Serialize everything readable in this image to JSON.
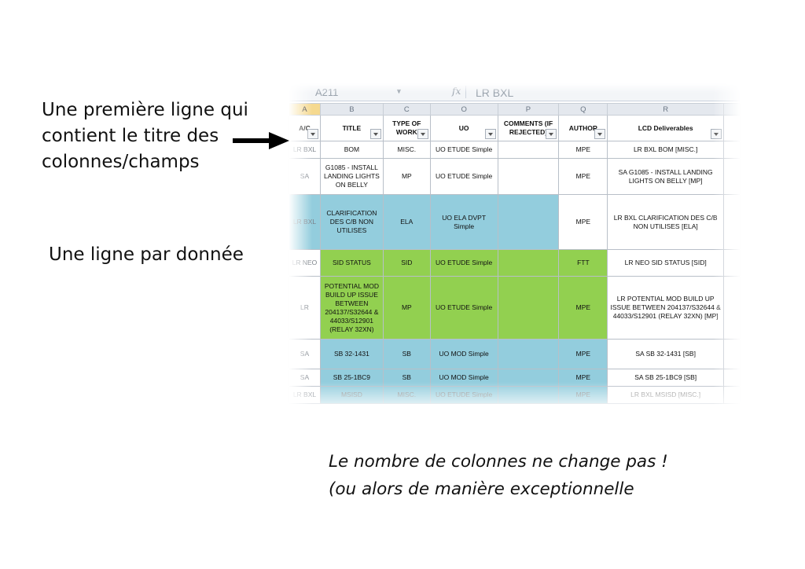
{
  "annotations": {
    "header_callout": "Une première ligne qui contient le titre des colonnes/champs",
    "row_callout": "Une ligne par donnée",
    "footer_line1": "Le nombre de colonnes ne change pas !",
    "footer_line2": "(ou alors de manière exceptionnelle"
  },
  "spreadsheet": {
    "name_box": "A211",
    "fx_icon": "fx-icon",
    "formula_value": "LR BXL",
    "column_letters": [
      "A",
      "B",
      "C",
      "O",
      "P",
      "Q",
      "R"
    ],
    "column_headers": [
      "A/C",
      "TITLE",
      "TYPE OF WORK",
      "UO",
      "COMMENTS (IF REJECTED)",
      "AUTHOR",
      "LCD Deliverables"
    ],
    "rows": [
      {
        "color": "white",
        "ac": "LR BXL",
        "title": "BOM",
        "type": "MISC.",
        "uo": "UO ETUDE Simple",
        "comments": "",
        "author": "MPE",
        "lcd": "LR BXL BOM [MISC.]"
      },
      {
        "color": "white",
        "ac": "SA",
        "title": "G1085 - INSTALL LANDING LIGHTS ON BELLY",
        "type": "MP",
        "uo": "UO ETUDE Simple",
        "comments": "",
        "author": "MPE",
        "lcd": "SA G1085 - INSTALL LANDING LIGHTS ON BELLY [MP]"
      },
      {
        "color": "blue",
        "ac": "LR BXL",
        "title": "CLARIFICATION DES C/B NON UTILISES",
        "type": "ELA",
        "uo": "UO ELA DVPT Simple",
        "comments": "",
        "author": "MPE",
        "lcd": "LR BXL CLARIFICATION DES C/B NON UTILISES [ELA]"
      },
      {
        "color": "green",
        "ac": "LR NEO",
        "title": "SID STATUS",
        "type": "SID",
        "uo": "UO ETUDE Simple",
        "comments": "",
        "author": "FTT",
        "lcd": "LR NEO SID STATUS [SID]"
      },
      {
        "color": "green",
        "ac": "LR",
        "title": "POTENTIAL MOD BUILD UP ISSUE BETWEEN 204137/S32644 & 44033/S12901 (RELAY 32XN)",
        "type": "MP",
        "uo": "UO ETUDE Simple",
        "comments": "",
        "author": "MPE",
        "lcd": "LR POTENTIAL MOD BUILD UP ISSUE BETWEEN 204137/S32644 & 44033/S12901 (RELAY 32XN) [MP]"
      },
      {
        "color": "blue",
        "ac": "SA",
        "title": "SB 32-1431",
        "type": "SB",
        "uo": "UO MOD Simple",
        "comments": "",
        "author": "MPE",
        "lcd": "SA SB 32-1431 [SB]"
      },
      {
        "color": "blue",
        "ac": "SA",
        "title": "SB 25-1BC9",
        "type": "SB",
        "uo": "UO MOD Simple",
        "comments": "",
        "author": "MPE",
        "lcd": "SA SB 25-1BC9 [SB]"
      },
      {
        "color": "blue",
        "ac": "LR BXL",
        "title": "MSISD",
        "type": "MISC.",
        "uo": "UO ETUDE Simple",
        "comments": "",
        "author": "MPE",
        "lcd": "LR BXL MSISD [MISC.]"
      }
    ]
  }
}
